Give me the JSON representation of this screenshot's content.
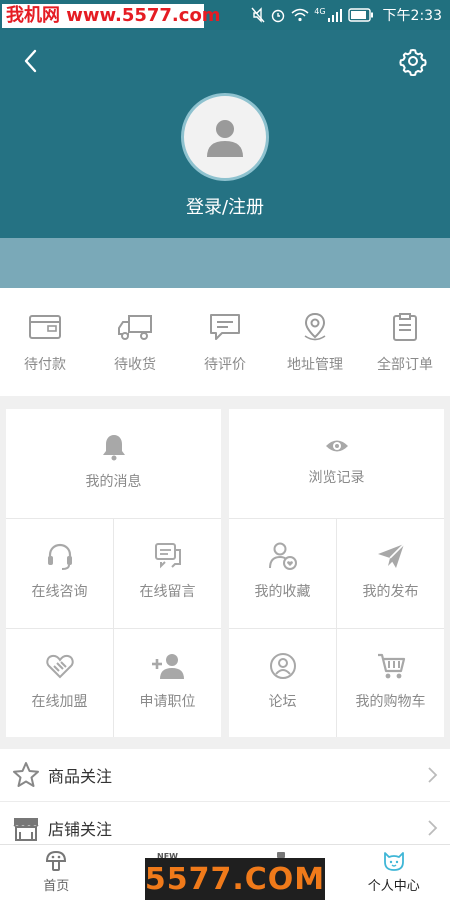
{
  "status_bar": {
    "watermark": "我机网 www.5577.com",
    "network": "4G",
    "time": "下午2:33"
  },
  "header": {
    "back_icon": "chevron-left-icon",
    "settings_icon": "gear-icon",
    "avatar_icon": "user-silhouette-icon",
    "login_label": "登录/注册"
  },
  "orders": [
    {
      "label": "待付款",
      "icon": "wallet-icon"
    },
    {
      "label": "待收货",
      "icon": "truck-icon"
    },
    {
      "label": "待评价",
      "icon": "comment-icon"
    },
    {
      "label": "地址管理",
      "icon": "location-pin-icon"
    },
    {
      "label": "全部订单",
      "icon": "clipboard-icon"
    }
  ],
  "grid": {
    "messages": {
      "label": "我的消息",
      "icon": "bell-icon"
    },
    "history": {
      "label": "浏览记录",
      "icon": "eye-icon"
    },
    "consult": {
      "label": "在线咨询",
      "icon": "headset-icon"
    },
    "leave_msg": {
      "label": "在线留言",
      "icon": "chat-bubbles-icon"
    },
    "favorites": {
      "label": "我的收藏",
      "icon": "user-heart-icon"
    },
    "publish": {
      "label": "我的发布",
      "icon": "paper-plane-icon"
    },
    "join": {
      "label": "在线加盟",
      "icon": "handshake-icon"
    },
    "apply_job": {
      "label": "申请职位",
      "icon": "user-plus-icon"
    },
    "forum": {
      "label": "论坛",
      "icon": "user-circle-icon"
    },
    "cart": {
      "label": "我的购物车",
      "icon": "cart-icon"
    }
  },
  "list": [
    {
      "label": "商品关注",
      "icon": "star-outline-icon"
    },
    {
      "label": "店铺关注",
      "icon": "store-icon"
    }
  ],
  "bottom_nav": [
    {
      "label": "首页",
      "icon": "home-mushroom-icon",
      "active": false
    },
    {
      "label": "",
      "icon": "new-news-icon",
      "active": false
    },
    {
      "label": "",
      "icon": "cart-badge-icon",
      "active": false
    },
    {
      "label": "个人中心",
      "icon": "cat-face-icon",
      "active": true
    }
  ],
  "watermark_bottom": "5577.COM",
  "colors": {
    "header": "#257283",
    "header_band": "#7aa9b8",
    "active_nav": "#3fb6d6",
    "icon_gray": "#9a9a9a"
  }
}
